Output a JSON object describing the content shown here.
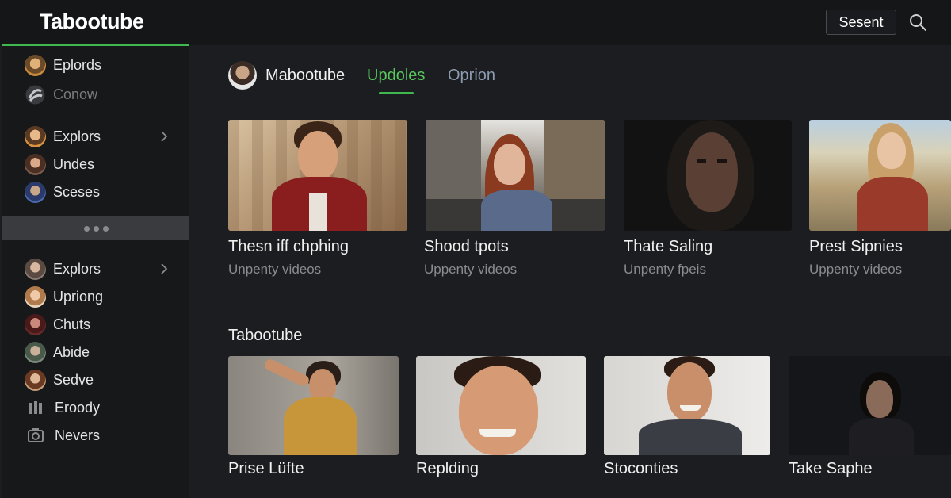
{
  "header": {
    "logo": "Tabootube",
    "action_button": "Sesent",
    "search_icon": "search-icon"
  },
  "sidebar": {
    "group1": [
      {
        "label": "Eplords",
        "icon": "avatar"
      },
      {
        "label": "Conow",
        "icon": "swirl-icon"
      }
    ],
    "group2": [
      {
        "label": "Explors",
        "icon": "avatar",
        "has_chevron": true
      },
      {
        "label": "Undes",
        "icon": "avatar"
      },
      {
        "label": "Sceses",
        "icon": "avatar"
      }
    ],
    "more_icon": "ellipsis-icon",
    "group3": [
      {
        "label": "Explors",
        "icon": "avatar",
        "has_chevron": true
      },
      {
        "label": "Upriong",
        "icon": "avatar"
      },
      {
        "label": "Chuts",
        "icon": "avatar"
      },
      {
        "label": "Abide",
        "icon": "avatar"
      },
      {
        "label": "Sedve",
        "icon": "avatar"
      },
      {
        "label": "Eroody",
        "icon": "library-icon"
      },
      {
        "label": "Nevers",
        "icon": "camera-icon"
      }
    ]
  },
  "channel": {
    "name": "Mabootube",
    "tabs": [
      {
        "label": "Updoles",
        "active": true
      },
      {
        "label": "Oprion",
        "active": false
      }
    ]
  },
  "row1": [
    {
      "title": "Thesn iff chphing",
      "subtitle": "Unpenty videos"
    },
    {
      "title": "Shood tpots",
      "subtitle": "Uppenty videos"
    },
    {
      "title": "Thate Saling",
      "subtitle": "Unpenty fpeis"
    },
    {
      "title": "Prest Sipnies",
      "subtitle": "Uppenty videos"
    }
  ],
  "section": {
    "title": "Tabootube"
  },
  "row2": [
    {
      "title": "Prise Lüfte"
    },
    {
      "title": "Replding"
    },
    {
      "title": "Stoconties"
    },
    {
      "title": "Take Saphe"
    }
  ],
  "colors": {
    "accent": "#3fb84f",
    "tab_active": "#58c95e",
    "tab_inactive": "#8c9bb0",
    "background": "#1c1d20",
    "sidebar": "#17181a"
  }
}
